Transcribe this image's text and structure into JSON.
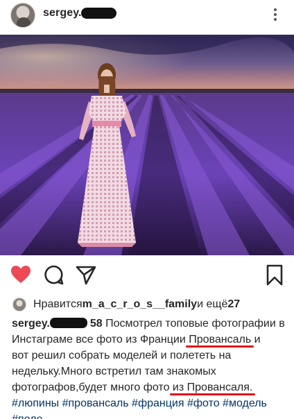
{
  "header": {
    "username": "sergey.",
    "more_icon": "more-vertical-icon"
  },
  "photo": {
    "alt_scene": "woman-in-lavender-field",
    "colors": {
      "lavender": "#6a3fb6",
      "sky": "#4c3a78",
      "dress": "#e9c6d3"
    }
  },
  "actions": {
    "like_icon": "heart-filled-icon",
    "comment_icon": "comment-icon",
    "share_icon": "send-icon",
    "save_icon": "bookmark-icon",
    "like_color": "#ed4956"
  },
  "likes": {
    "prefix": "Нравится ",
    "user": "m_a_c_r_o_s__family",
    "suffix": " и ещё ",
    "count": "27"
  },
  "caption": {
    "username": "sergey.",
    "username_tail": "58",
    "l1_rest": " Посмотрел топовые фотографии в",
    "l2_a": "Инстаграме все фото из Франции ",
    "l2_b": "Провансаль",
    "l2_c": " и",
    "l3": "вот решил собрать моделей и полететь на",
    "l4": "недельку.Много встретил там знакомых",
    "l5_a": "фотографов,будет много фото ",
    "l5_b": "из Провансаля.",
    "tags_1": "#люпины #провансаль #франция #фото #модель",
    "tags_2": "#поле"
  }
}
